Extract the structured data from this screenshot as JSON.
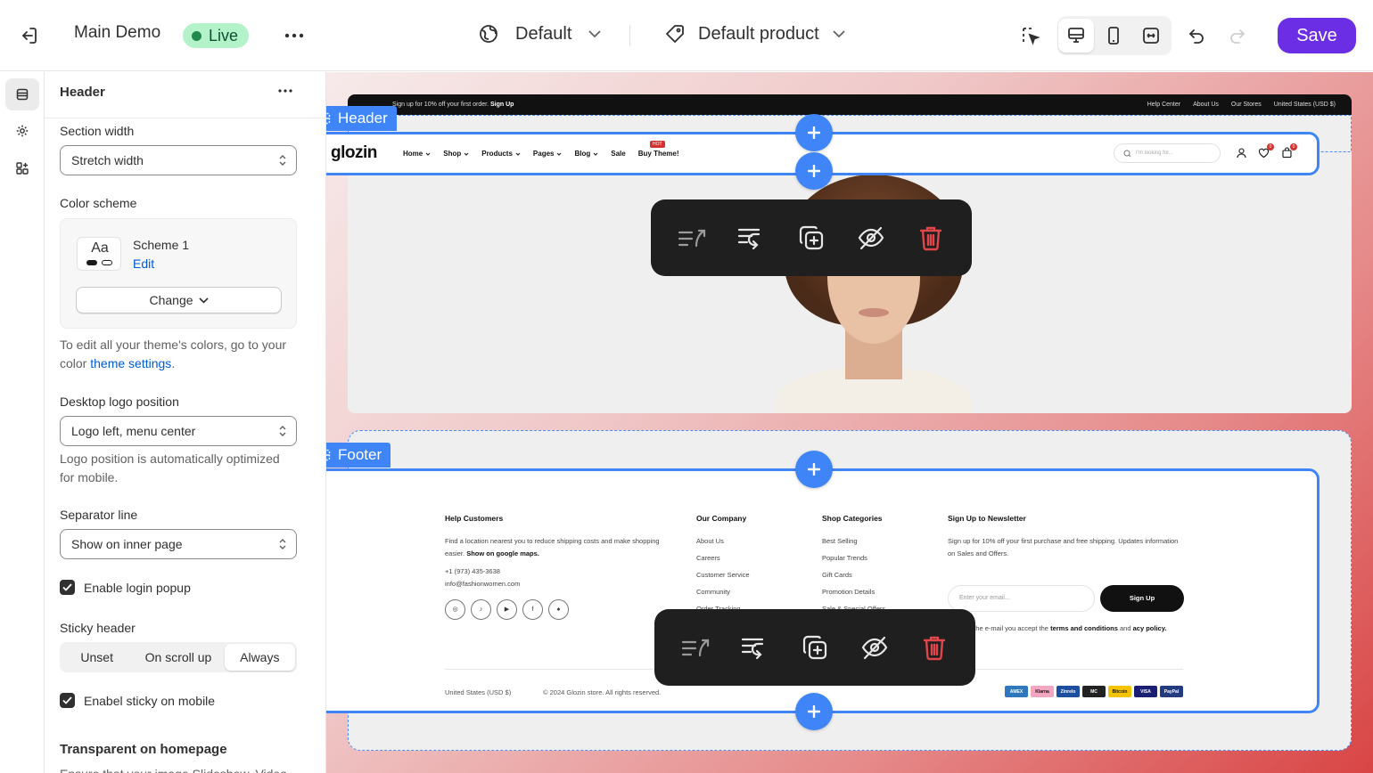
{
  "topbar": {
    "store_name": "Main Demo",
    "live_label": "Live",
    "theme_dropdown": "Default",
    "template_dropdown": "Default product",
    "save_label": "Save"
  },
  "panel": {
    "title": "Header",
    "section_width_label": "Section width",
    "section_width_value": "Stretch width",
    "color_scheme_label": "Color scheme",
    "scheme_aa": "Aa",
    "scheme_name": "Scheme 1",
    "scheme_edit": "Edit",
    "change_label": "Change",
    "help_colors_prefix": "To edit all your theme's colors, go to your color",
    "help_colors_link": "theme settings",
    "help_colors_suffix": ".",
    "logo_position_label": "Desktop logo position",
    "logo_position_value": "Logo left, menu center",
    "logo_help": "Logo position is automatically optimized for mobile.",
    "separator_label": "Separator line",
    "separator_value": "Show on inner page",
    "login_popup_label": "Enable login popup",
    "sticky_label": "Sticky header",
    "sticky_options": [
      "Unset",
      "On scroll up",
      "Always"
    ],
    "sticky_selected": "Always",
    "sticky_mobile_label": "Enabel sticky on mobile",
    "transparent_heading": "Transparent on homepage",
    "transparent_help_partial": "Ensure that your image Slideshow, Video"
  },
  "preview": {
    "header_tag": "Header",
    "footer_tag": "Footer",
    "announcement": {
      "text_prefix": "Sign up for 10% off your first order.",
      "text_link": "Sign Up",
      "links": [
        "Help Center",
        "About Us",
        "Our Stores",
        "United States (USD $)"
      ]
    },
    "nav": {
      "logo": "glozin",
      "menu": [
        "Home",
        "Shop",
        "Products",
        "Pages",
        "Blog",
        "Sale",
        "Buy Theme!"
      ],
      "hot_badge": "HOT",
      "search_placeholder": "I'm looking for...",
      "wishlist_count": "0",
      "cart_count": "0"
    },
    "footer": {
      "help_title": "Help Customers",
      "help_text": "Find a location nearest you to reduce shipping costs and make shopping easier.",
      "help_link": "Show on google maps.",
      "phone": "+1 (973) 435-3638",
      "email": "info@fashionwomen.com",
      "company_title": "Our Company",
      "company_links": [
        "About Us",
        "Careers",
        "Customer Service",
        "Community",
        "Order Tracking"
      ],
      "shop_title": "Shop Categories",
      "shop_links": [
        "Best Selling",
        "Popular Trends",
        "Gift Cards",
        "Promotion Details",
        "Sale & Special Offers"
      ],
      "newsletter_title": "Sign Up to Newsletter",
      "newsletter_text": "Sign up for 10% off your first purchase and free shipping. Updates information on Sales and Offers.",
      "email_placeholder": "Enter your email...",
      "signup_label": "Sign Up",
      "consent_prefix": "entering the e-mail you accept the",
      "consent_terms": "terms and conditions",
      "consent_mid": "and",
      "consent_policy": "acy policy.",
      "currency": "United States (USD $)",
      "copyright": "© 2024 Glozin store. All rights reserved.",
      "payments": [
        "AMEX",
        "Klarna",
        "Zinrelo",
        "MC",
        "Bitcoin",
        "VISA",
        "PayPal"
      ]
    }
  },
  "colors": {
    "accent_blue": "#3f85f7",
    "save_purple": "#6b2ee5",
    "live_green": "#b4f2c9",
    "delete_red": "#e0464a"
  }
}
